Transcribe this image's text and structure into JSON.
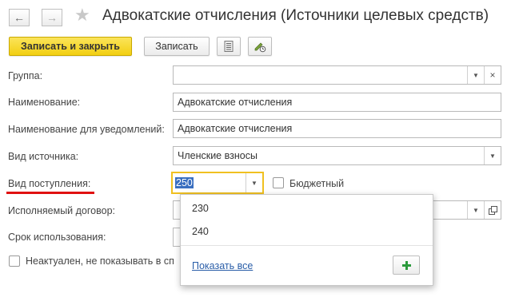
{
  "header": {
    "title": "Адвокатские отчисления (Источники целевых средств)",
    "back_icon": "arrow-left-icon",
    "forward_icon": "arrow-right-icon",
    "favorite_icon": "star-icon"
  },
  "toolbar": {
    "save_close_label": "Записать и закрыть",
    "save_label": "Записать",
    "report_icon": "document-list-icon",
    "edit_icon": "edit-settings-icon"
  },
  "form": {
    "group": {
      "label": "Группа:",
      "value": ""
    },
    "name": {
      "label": "Наименование:",
      "value": "Адвокатские отчисления"
    },
    "notify_name": {
      "label": "Наименование для уведомлений:",
      "value": "Адвокатские отчисления"
    },
    "source_type": {
      "label": "Вид источника:",
      "value": "Членские взносы"
    },
    "receipt_type": {
      "label": "Вид поступления:",
      "value": "250"
    },
    "budget": {
      "label": "Бюджетный",
      "checked": false
    },
    "contract": {
      "label": "Исполняемый договор:",
      "value": ""
    },
    "usage_term": {
      "label": "Срок использования:",
      "value": ""
    },
    "inactive": {
      "label": "Неактуален, не показывать в сп"
    }
  },
  "dropdown": {
    "options": [
      "230",
      "240"
    ],
    "show_all_label": "Показать все",
    "add_icon": "plus-icon"
  },
  "colors": {
    "accent_yellow": "#f5d31a",
    "focus_border": "#f0c020",
    "link_blue": "#2a5ea8",
    "selection_blue": "#3a6fc0",
    "annotation_red": "#e01010",
    "plus_green": "#2b9a3c"
  }
}
